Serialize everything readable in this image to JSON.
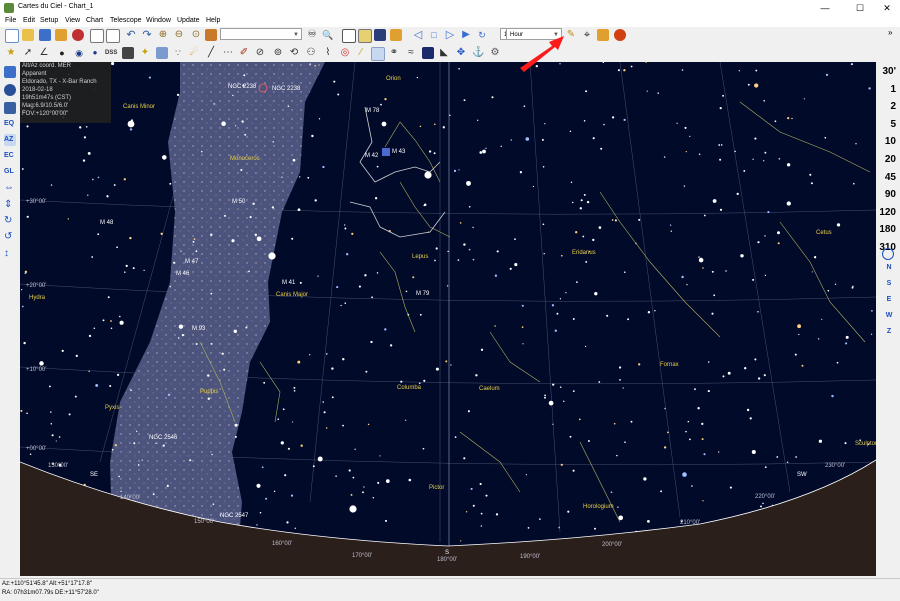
{
  "window": {
    "title": "Cartes du Ciel - Chart_1",
    "min": "—",
    "max": "☐",
    "close": "✕"
  },
  "menu": [
    "File",
    "Edit",
    "Setup",
    "View",
    "Chart",
    "Telescope",
    "Window",
    "Update",
    "Help"
  ],
  "toolbar": {
    "search_value": "",
    "step_value": "1",
    "time_unit": "Hour"
  },
  "infobox": {
    "lines": [
      "Alt/Az coord. MER",
      "Apparent",
      "Eldorado, TX - X-Bar Ranch",
      "2018-02-18",
      "19h51m47s (CST)",
      "Mag:6.9/10.5/6.0'",
      "FOV:+120°00'00\""
    ]
  },
  "fov_buttons": [
    "30'",
    "1",
    "2",
    "5",
    "10",
    "20",
    "45",
    "90",
    "120",
    "180",
    "310"
  ],
  "directions": [
    "N",
    "S",
    "E",
    "W",
    "Z"
  ],
  "status": {
    "altaz": "Az:+110°51'45.8\" Alt:+51°17'17.8\"",
    "radec": "RA: 07h31m07.79s DE:+11°57'28.0\""
  },
  "chart_labels": {
    "constellations": [
      "Orion",
      "Canis Minor",
      "Monoceros",
      "Lepus",
      "Eridanus",
      "Cetus",
      "Canis Major",
      "Hydra",
      "Columba",
      "Caelum",
      "Fornax",
      "Puppis",
      "Pyxis",
      "Pictor",
      "Horologium",
      "Sculptor"
    ],
    "objects": [
      "NGC 2238",
      "NGC 2238",
      "M 78",
      "M 42",
      "M 43",
      "M 50",
      "M 48",
      "M 47",
      "M 46",
      "M 41",
      "M 79",
      "M 93",
      "NGC 2546",
      "NGC 2547"
    ],
    "dec_labels": [
      "+30°00'",
      "+20°00'",
      "+10°00'",
      "+00°00'"
    ],
    "az_labels": [
      "130°00'",
      "140°00'",
      "150°00'",
      "160°00'",
      "170°00'",
      "180°00'",
      "190°00'",
      "200°00'",
      "210°00'",
      "220°00'",
      "230°00'"
    ],
    "horizon_dirs": [
      "SE",
      "S",
      "SW"
    ]
  }
}
